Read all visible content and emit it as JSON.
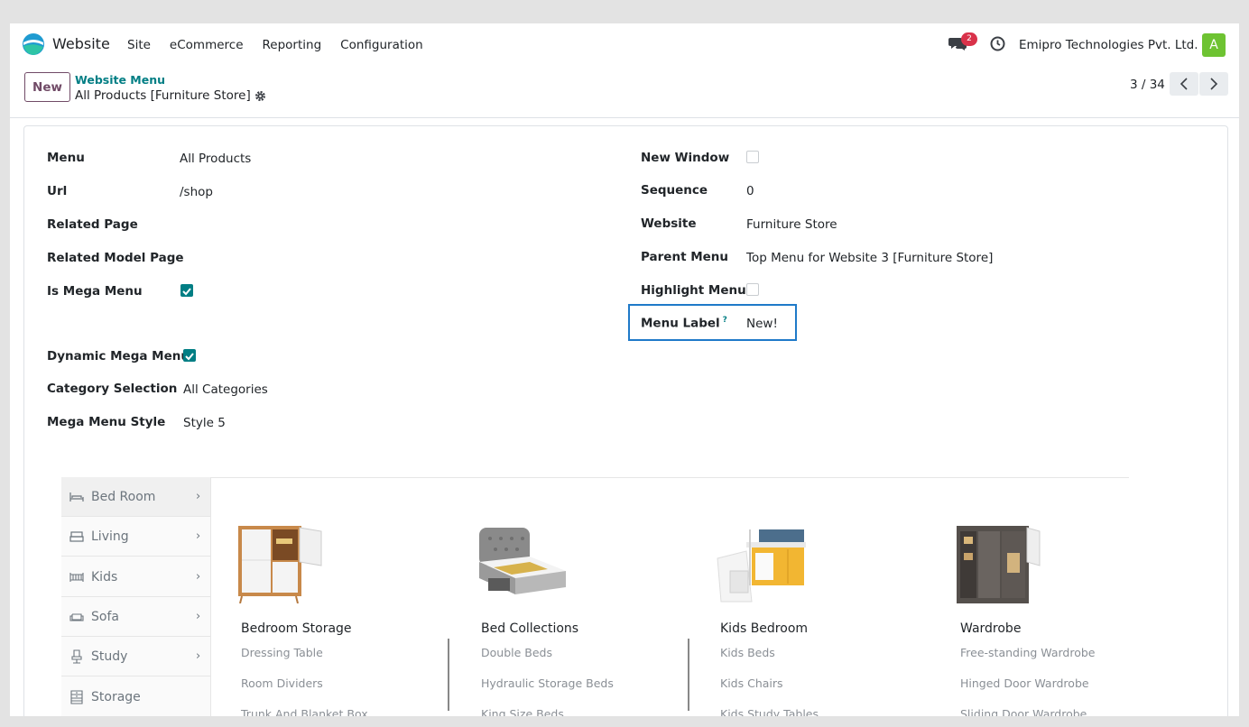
{
  "navbar": {
    "app_name": "Website",
    "menu": [
      "Site",
      "eCommerce",
      "Reporting",
      "Configuration"
    ],
    "chat_badge": "2",
    "company": "Emipro Technologies Pvt. Ltd.",
    "avatar_letter": "A",
    "icons": [
      "website-logo-icon",
      "chat-icon",
      "clock-icon"
    ]
  },
  "control_panel": {
    "new_label": "New",
    "breadcrumb": "Website Menu",
    "record_title": "All Products [Furniture Store]",
    "pager": "3 / 34"
  },
  "form": {
    "left": {
      "menu_label": "Menu",
      "menu_value": "All Products",
      "url_label": "Url",
      "url_value": "/shop",
      "related_page_label": "Related Page",
      "related_model_page_label": "Related Model Page",
      "is_mega_menu_label": "Is Mega Menu",
      "is_mega_menu_checked": true,
      "dynamic_mega_menu_label": "Dynamic Mega Menu",
      "dynamic_mega_menu_checked": true,
      "category_selection_label": "Category Selection",
      "category_selection_value": "All Categories",
      "mega_menu_style_label": "Mega Menu Style",
      "mega_menu_style_value": "Style 5"
    },
    "right": {
      "new_window_label": "New Window",
      "new_window_checked": false,
      "sequence_label": "Sequence",
      "sequence_value": "0",
      "website_label": "Website",
      "website_value": "Furniture Store",
      "parent_menu_label": "Parent Menu",
      "parent_menu_value": "Top Menu for Website 3 [Furniture Store]",
      "highlight_menu_label": "Highlight Menu",
      "highlight_menu_checked": false,
      "menu_label_label": "Menu Label",
      "menu_label_help": "?",
      "menu_label_value": "New!"
    }
  },
  "preview": {
    "sidebar": [
      {
        "label": "Bed Room",
        "icon": "bed-icon"
      },
      {
        "label": "Living",
        "icon": "living-icon"
      },
      {
        "label": "Kids",
        "icon": "kids-icon"
      },
      {
        "label": "Sofa",
        "icon": "sofa-icon"
      },
      {
        "label": "Study",
        "icon": "study-icon"
      },
      {
        "label": "Storage",
        "icon": "storage-icon"
      }
    ],
    "columns": [
      {
        "title": "Bedroom Storage",
        "links": [
          "Dressing Table",
          "Room Dividers",
          "Trunk And Blanket Box"
        ]
      },
      {
        "title": "Bed Collections",
        "links": [
          "Double Beds",
          "Hydraulic Storage Beds",
          "King Size Beds"
        ]
      },
      {
        "title": "Kids Bedroom",
        "links": [
          "Kids Beds",
          "Kids Chairs",
          "Kids Study Tables"
        ]
      },
      {
        "title": "Wardrobe",
        "links": [
          "Free-standing Wardrobe",
          "Hinged Door Wardrobe",
          "Sliding Door Wardrobe"
        ]
      }
    ]
  },
  "colors": {
    "brand": "#714b67",
    "accent": "#017e84",
    "badge": "#d9324a",
    "highlight_border": "#1f7ac9"
  }
}
